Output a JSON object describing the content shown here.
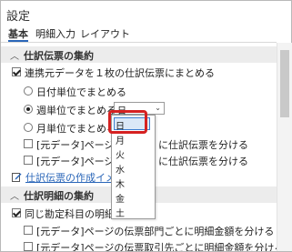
{
  "window": {
    "title": "設定"
  },
  "tabs": [
    {
      "label": "基本"
    },
    {
      "label": "明細入力"
    },
    {
      "label": "レイアウト"
    }
  ],
  "section1": {
    "header": "仕訳伝票の集約",
    "merge_checkbox": "連携元データを１枚の仕訳伝票にまとめる",
    "radio_daily": "日付単位でまとめる",
    "radio_weekly": "週単位でまとめる",
    "weekday_select_value": "日",
    "radio_monthly": "月単位でまとめる",
    "option_row1": "[元データ]ページの",
    "option_row1_tail": "に仕訳伝票を分ける",
    "option_row2": "[元データ]ページの",
    "option_row2_tail": "に仕訳伝票を分ける",
    "link_text": "仕訳伝票の作成イメー"
  },
  "dropdown": {
    "options": [
      "日",
      "月",
      "火",
      "水",
      "木",
      "金",
      "土"
    ],
    "selected_index": 0
  },
  "section2": {
    "header": "仕訳明細の集約",
    "checkbox_same_account": "同じ勘定科目の明細金額",
    "checkbox_dept": "[元データ]ページの伝票部門ごとに明細金額を分ける",
    "checkbox_partner": "[元データ]ページの伝票取引先ごとに明細金額を分ける"
  },
  "colors": {
    "accent": "#2a66b8",
    "highlight_border": "#d52121"
  },
  "icons": {
    "collapse": "chevron-up-icon",
    "edit": "pencil-edit-icon",
    "select": "chevron-down-icon"
  }
}
